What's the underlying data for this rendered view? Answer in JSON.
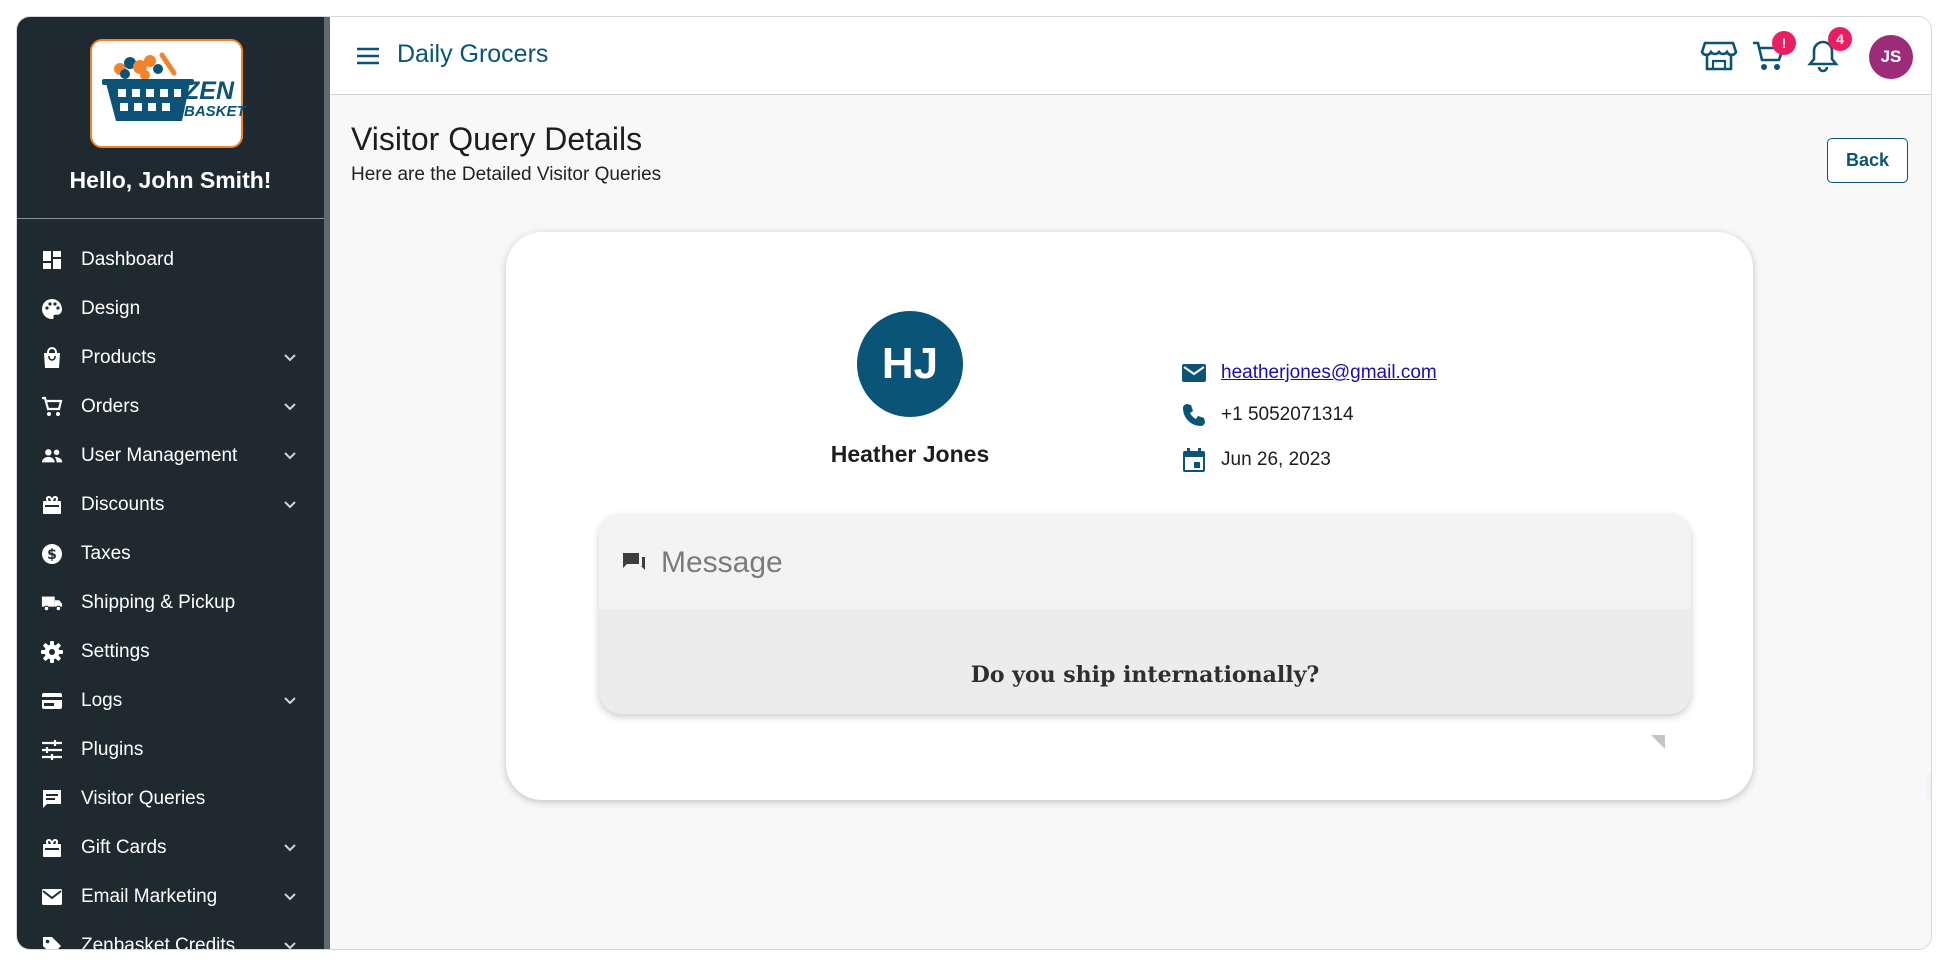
{
  "sidebar": {
    "logo": {
      "text_line1": "ZEN",
      "text_line2": "BASKET"
    },
    "greeting": "Hello, John Smith!",
    "items": [
      {
        "label": "Dashboard",
        "icon": "dashboard-icon",
        "expandable": false
      },
      {
        "label": "Design",
        "icon": "palette-icon",
        "expandable": false
      },
      {
        "label": "Products",
        "icon": "shopping-bag-icon",
        "expandable": true
      },
      {
        "label": "Orders",
        "icon": "cart-icon",
        "expandable": true
      },
      {
        "label": "User Management",
        "icon": "people-icon",
        "expandable": true
      },
      {
        "label": "Discounts",
        "icon": "gift-box-icon",
        "expandable": true
      },
      {
        "label": "Taxes",
        "icon": "dollar-circle-icon",
        "expandable": false
      },
      {
        "label": "Shipping & Pickup",
        "icon": "truck-icon",
        "expandable": false
      },
      {
        "label": "Settings",
        "icon": "gear-icon",
        "expandable": false
      },
      {
        "label": "Logs",
        "icon": "card-icon",
        "expandable": true
      },
      {
        "label": "Plugins",
        "icon": "sliders-icon",
        "expandable": false
      },
      {
        "label": "Visitor Queries",
        "icon": "message-icon",
        "expandable": false
      },
      {
        "label": "Gift Cards",
        "icon": "gift-card-icon",
        "expandable": true
      },
      {
        "label": "Email Marketing",
        "icon": "mail-icon",
        "expandable": true
      },
      {
        "label": "Zenbasket Credits",
        "icon": "tag-icon",
        "expandable": true
      }
    ]
  },
  "header": {
    "store_name": "Daily Grocers",
    "cart_badge": "!",
    "notification_badge": "4",
    "user_initials": "JS"
  },
  "page": {
    "title": "Visitor Query Details",
    "subtitle": "Here are the Detailed Visitor Queries",
    "back_label": "Back"
  },
  "visitor": {
    "initials": "HJ",
    "name": "Heather Jones",
    "email": "heatherjones@gmail.com",
    "phone": "+1 5052071314",
    "date": "Jun 26, 2023"
  },
  "message": {
    "label": "Message",
    "text": "Do you ship internationally?"
  },
  "colors": {
    "sidebar_bg": "#1f2930",
    "brand": "#0c5377",
    "avatar_bg": "#0a5577",
    "user_avatar_bg": "#9c2c78",
    "badge": "#e91e63",
    "logo_orange": "#f0832b"
  }
}
